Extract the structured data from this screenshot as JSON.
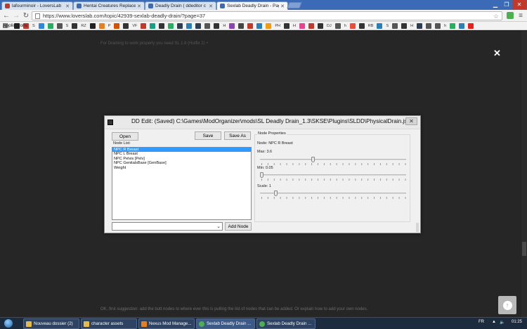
{
  "browser": {
    "tabs": [
      {
        "label": "lafourminoir - LoversLab",
        "fav_color": "#c0392b",
        "active": false
      },
      {
        "label": "Hentai Creatures Replacer",
        "fav_color": "#3b6bb6",
        "active": false
      },
      {
        "label": "Deadly Drain ( ddeditor c",
        "fav_color": "#3b6bb6",
        "active": false
      },
      {
        "label": "Sexlab Deadly Drain - Pag",
        "fav_color": "#3b6bb6",
        "active": true
      }
    ],
    "url": "https://www.loverslab.com/topic/42939-sexlab-deadly-drain/?page=37",
    "bookmarks": {
      "apps_label": "Applications",
      "items": [
        {
          "icon": "sl-icon",
          "label": "",
          "color": "#222"
        },
        {
          "icon": "s-icon",
          "label": "S",
          "color": "#c0392b"
        },
        {
          "icon": "drop-icon",
          "label": "",
          "color": "#2e86de"
        },
        {
          "icon": "leaf-icon",
          "label": "",
          "color": "#27ae60"
        },
        {
          "icon": "s2-icon",
          "label": "S",
          "color": "#555"
        },
        {
          "icon": "rz-icon",
          "label": "RZ",
          "color": "#333"
        },
        {
          "icon": "dark-icon",
          "label": "",
          "color": "#222"
        },
        {
          "icon": "p-icon",
          "label": "P",
          "color": "#e67e22"
        },
        {
          "icon": "flame-icon",
          "label": "",
          "color": "#d35400"
        },
        {
          "icon": "vf-icon",
          "label": "VF",
          "color": "#333"
        },
        {
          "icon": "m-icon",
          "label": "",
          "color": "#c0392b"
        },
        {
          "icon": "box-icon",
          "label": "",
          "color": "#16a085"
        },
        {
          "icon": "skull-icon",
          "label": "",
          "color": "#333"
        },
        {
          "icon": "g-icon",
          "label": "",
          "color": "#27ae60"
        },
        {
          "icon": "wp-icon",
          "label": "",
          "color": "#2c3e50"
        },
        {
          "icon": "mail-icon",
          "label": "",
          "color": "#2980b9"
        },
        {
          "icon": "d-icon",
          "label": "",
          "color": "#2c3e50"
        },
        {
          "icon": "dice-icon",
          "label": "",
          "color": "#555"
        },
        {
          "icon": "h-icon",
          "label": "H",
          "color": "#333"
        },
        {
          "icon": "eye-icon",
          "label": "",
          "color": "#8e44ad"
        },
        {
          "icon": "grid-icon",
          "label": "",
          "color": "#444"
        },
        {
          "icon": "o-icon",
          "label": "",
          "color": "#c0392b"
        },
        {
          "icon": "star-icon",
          "label": "",
          "color": "#2980b9"
        },
        {
          "icon": "ph-icon",
          "label": "PH",
          "color": "#f39c12"
        },
        {
          "icon": "h2-icon",
          "label": "H",
          "color": "#333"
        },
        {
          "icon": "pink-icon",
          "label": "",
          "color": "#e84393"
        },
        {
          "icon": "c-icon",
          "label": "",
          "color": "#c0392b"
        },
        {
          "icon": "dj-icon",
          "label": "DJ",
          "color": "#333"
        },
        {
          "icon": "h3-icon",
          "label": "h",
          "color": "#555"
        },
        {
          "icon": "flag-icon",
          "label": "",
          "color": "#e74c3c"
        },
        {
          "icon": "rb-icon",
          "label": "RB",
          "color": "#333"
        },
        {
          "icon": "s3-icon",
          "label": "S",
          "color": "#2980b9"
        },
        {
          "icon": "bat-icon",
          "label": "",
          "color": "#555"
        },
        {
          "icon": "h4-icon",
          "label": "H",
          "color": "#333"
        },
        {
          "icon": "lp-icon",
          "label": "",
          "color": "#2c3e50"
        },
        {
          "icon": "lock-icon",
          "label": "",
          "color": "#555"
        },
        {
          "icon": "h5-icon",
          "label": "h",
          "color": "#555"
        },
        {
          "icon": "shop-icon",
          "label": "",
          "color": "#27ae60"
        },
        {
          "icon": "e-icon",
          "label": "",
          "color": "#2980b9"
        },
        {
          "icon": "yt-icon",
          "label": "",
          "color": "#e62117"
        }
      ]
    }
  },
  "page": {
    "snippet_top": "requirements",
    "snippet_line": "For Draining to work properly you need SL 1.6 (Hotfix 2) +",
    "comment": "OK, first suggestion: add the butt nodes to where ever this is pulling the list of nodes that can be added. Or explain how to add your own nodes."
  },
  "dialog": {
    "title": "DD Edit: (Saved) C:\\Games\\ModOrganizer\\mods\\SL Deadly Drain_1.3\\SKSE\\Plugins\\SLDD\\PhysicalDrain.json",
    "buttons": {
      "open": "Open",
      "save": "Save",
      "save_as": "Save As",
      "add_node": "Add Node"
    },
    "node_list_label": "Node List:",
    "nodes": [
      "NPC R Breast",
      "NPC L Breast",
      "NPC Pelvis [Pelv]",
      "NPC GenitalsBase [GenBase]",
      "Weight"
    ],
    "selected_index": 0,
    "combo_value": "",
    "properties": {
      "group_label": "Node Properties",
      "node_text": "Node: NPC R Breast",
      "max_label": "Max: 3.6",
      "min_label": "Min: 0.05",
      "scale_label": "Scale: 1",
      "max_level": 0.36,
      "min_level": 0.0,
      "scale_level": 0.1
    }
  },
  "taskbar": {
    "items": [
      {
        "label": "Nouveau dossier (2)",
        "icon": "folder-icon",
        "color": "#e5b94a"
      },
      {
        "label": "character assets",
        "icon": "folder-icon",
        "color": "#e5b94a"
      },
      {
        "label": "Nexus Mod Manage...",
        "icon": "nmm-icon",
        "color": "#e67e22"
      },
      {
        "label": "Sexlab Deadly Drain ...",
        "icon": "chrome-icon",
        "color": "#4caf50"
      },
      {
        "label": "Sexlab Deadly Drain ...",
        "icon": "chrome-icon",
        "color": "#4caf50"
      }
    ],
    "lang": "FR",
    "time": "01:25"
  }
}
